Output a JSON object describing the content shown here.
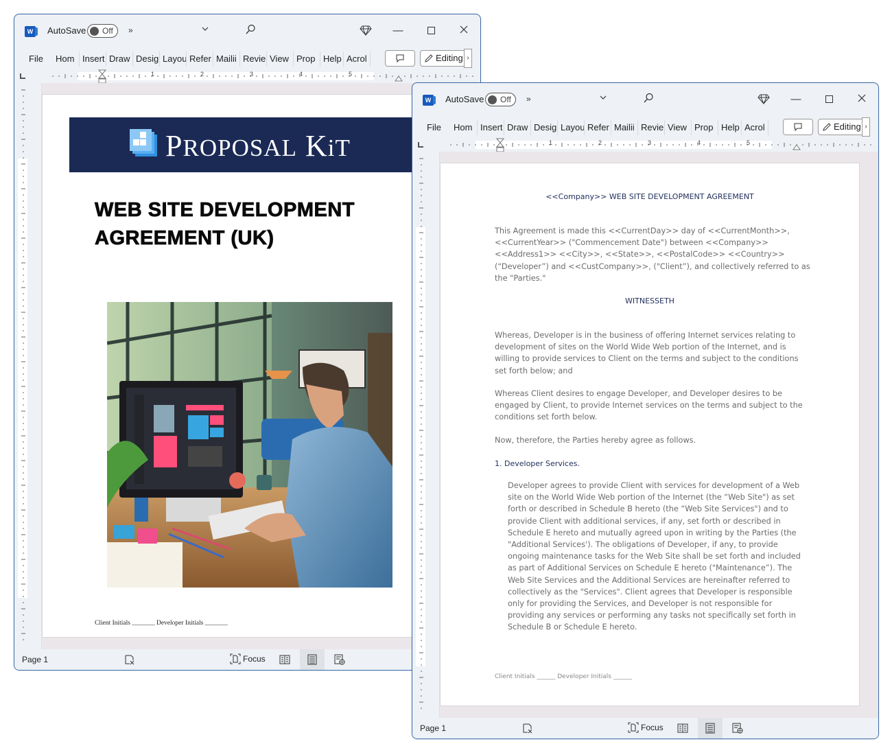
{
  "windows": [
    {
      "id": "cover",
      "titlebar": {
        "autosave_label": "AutoSave",
        "autosave_state": "Off",
        "more_label": "»",
        "app_icon_letter": "W"
      },
      "ribbon": {
        "tabs": [
          "File",
          "Home",
          "Insert",
          "Draw",
          "Design",
          "Layout",
          "References",
          "Mailings",
          "Review",
          "View",
          "Proposal",
          "Help",
          "Acrobat"
        ],
        "tabs_visible": [
          "File",
          "Hom",
          "Insert",
          "Draw",
          "Desig",
          "Layou",
          "Refer",
          "Mailii",
          "Revie",
          "View",
          "Prop",
          "Help",
          "Acrol"
        ],
        "editing_label": "Editing",
        "editing_more": "›"
      },
      "ruler_numbers": [
        "1",
        "2",
        "3",
        "4",
        "5"
      ],
      "status": {
        "page": "Page 1",
        "focus_label": "Focus"
      }
    },
    {
      "id": "agreement",
      "titlebar": {
        "autosave_label": "AutoSave",
        "autosave_state": "Off",
        "more_label": "»",
        "app_icon_letter": "W"
      },
      "ribbon": {
        "tabs_visible": [
          "File",
          "Hom",
          "Insert",
          "Draw",
          "Desig",
          "Layou",
          "Refer",
          "Mailii",
          "Revie",
          "View",
          "Prop",
          "Help",
          "Acrol"
        ],
        "editing_label": "Editing",
        "editing_more": "›"
      },
      "ruler_numbers": [
        "1",
        "2",
        "3",
        "4",
        "5"
      ],
      "status": {
        "page": "Page 1",
        "focus_label": "Focus"
      }
    }
  ],
  "cover_page": {
    "brand_main": "PROPOSAL KIT",
    "brand_p": "P",
    "brand_roposal": "ROPOSAL",
    "brand_k": "K",
    "brand_it": "IT",
    "title_line1": "WEB SITE DEVELOPMENT",
    "title_line2": "AGREEMENT (UK)",
    "image_alt": "Developer working at a desktop computer in a bright office",
    "initials": "Client Initials  _______ Developer Initials _______"
  },
  "agreement_page": {
    "title": "<<Company>> WEB SITE DEVELOPMENT AGREEMENT",
    "intro": "This Agreement is made this <<CurrentDay>> day of <<CurrentMonth>>, <<CurrentYear>> (\"Commencement Date\") between <<Company>> <<Address1>> <<City>>, <<State>>, <<PostalCode>> <<Country>> (“Developer”) and <<CustCompany>>, (\"Client”), and collectively referred to as the \"Parties.\"",
    "witnesseth": "WITNESSETH",
    "whereas1": "Whereas, Developer is in the business of offering Internet services relating to development of sites on the World Wide Web portion of the Internet, and is willing to provide services to Client on the terms and subject to the conditions set forth below; and",
    "whereas2": "Whereas Client desires to engage Developer, and Developer desires to be engaged by Client, to provide Internet services on the terms and subject to the conditions set forth below.",
    "now_therefore": "Now, therefore, the Parties hereby agree as follows.",
    "section1_heading": "1. Developer Services.",
    "section1_body": "Developer agrees to provide Client with services for development of a Web site on the World Wide Web portion of the Internet (the “Web Site\") as set forth or described in Schedule B hereto (the “Web Site Services\") and to provide Client with additional services, if any, set forth or described in Schedule E hereto and mutually agreed upon in writing by the Parties (the \"Additional Services'). The obligations of Developer, if any, to provide ongoing maintenance tasks for the Web Site shall be set forth and included as part of Additional Services on Schedule E hereto (\"Maintenance”).  The Web Site Services and the Additional Services are hereinafter referred to collectively as the \"Services\". Client agrees that Developer is responsible only for providing the Services, and Developer is not responsible for providing any services or performing any tasks not specifically set forth in Schedule B or Schedule E hereto.",
    "initials": "Client Initials  ______ Developer Initials ______"
  },
  "colors": {
    "window_border": "#3a6aa8",
    "chrome_bg": "#eef1f5",
    "doc_bg": "#ebe6ea",
    "banner_navy": "#1b2a55",
    "heading_navy": "#1f2d5a",
    "body_gray": "#6b6b6b",
    "word_blue": "#185abd"
  }
}
